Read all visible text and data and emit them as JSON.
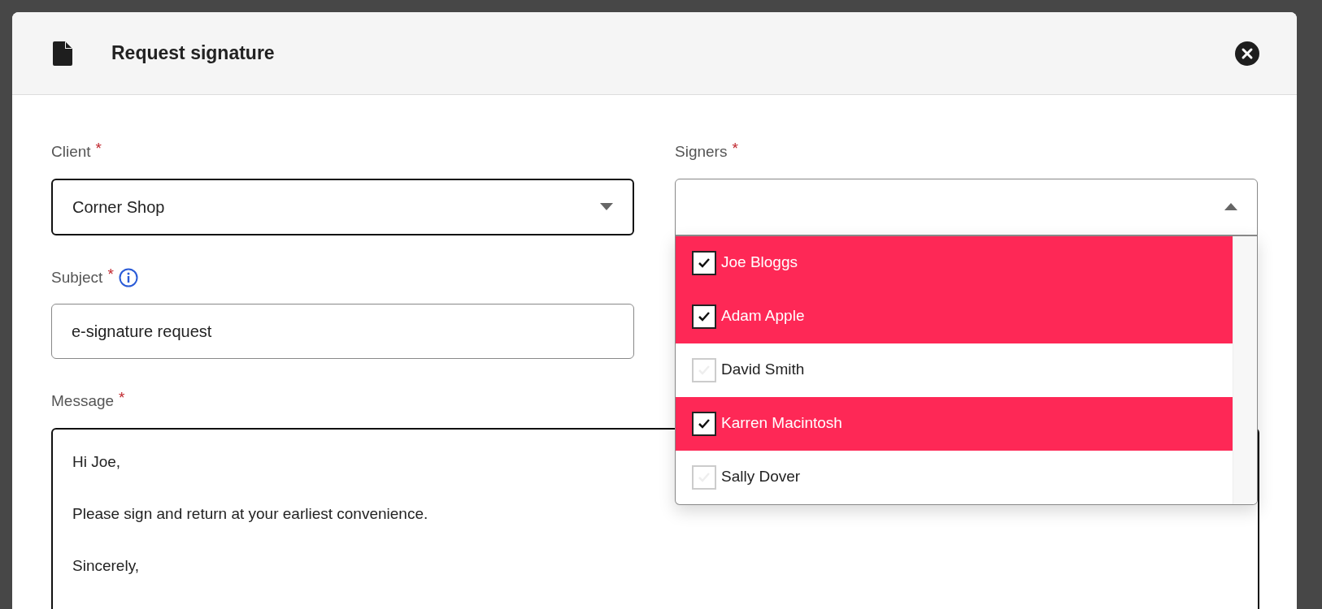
{
  "dialog": {
    "title": "Request signature"
  },
  "client": {
    "label": "Client",
    "required_mark": "*",
    "value": "Corner Shop"
  },
  "subject": {
    "label": "Subject",
    "required_mark": "*",
    "value": "e-signature request"
  },
  "message": {
    "label": "Message",
    "required_mark": "*",
    "paragraphs": [
      "Hi Joe,",
      "Please sign and return at your earliest convenience.",
      "Sincerely,"
    ]
  },
  "signers": {
    "label": "Signers",
    "required_mark": "*",
    "expanded": true,
    "options": [
      {
        "name": "Joe Bloggs",
        "checked": true
      },
      {
        "name": "Adam Apple",
        "checked": true
      },
      {
        "name": "David Smith",
        "checked": false
      },
      {
        "name": "Karren Macintosh",
        "checked": true
      },
      {
        "name": "Sally Dover",
        "checked": false
      }
    ]
  }
}
